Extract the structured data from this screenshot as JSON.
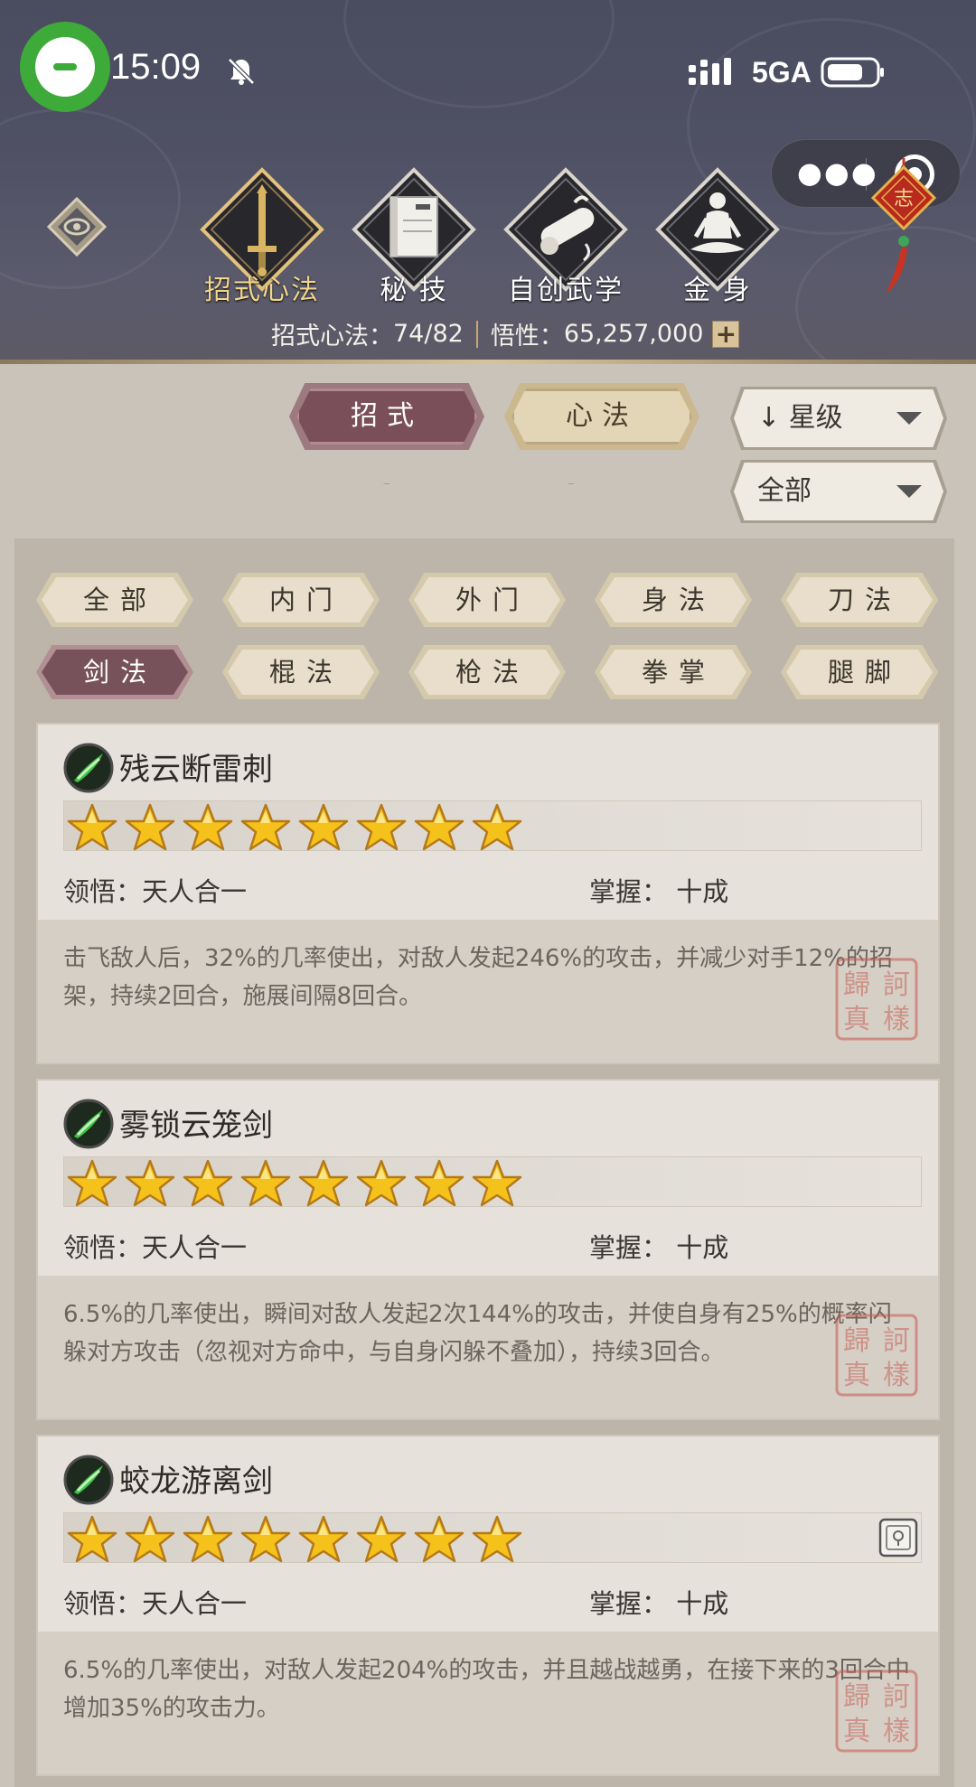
{
  "status_bar": {
    "time": "15:09",
    "network": "5GA"
  },
  "tabs": [
    {
      "label": "招式心法",
      "icon": "sword-icon",
      "active": true
    },
    {
      "label": "秘 技",
      "icon": "book-icon",
      "active": false
    },
    {
      "label": "自创武学",
      "icon": "scroll-icon",
      "active": false
    },
    {
      "label": "金 身",
      "icon": "meditation-icon",
      "active": false
    }
  ],
  "stats": {
    "count_label": "招式心法：",
    "count_value": "74/82",
    "insight_label": "悟性：",
    "insight_value": "65,257,000",
    "plus": "+"
  },
  "toggles": {
    "moves": "招式",
    "methods": "心法"
  },
  "dropdowns": {
    "sort": "星级",
    "sort_arrow": "↓",
    "filter": "全部"
  },
  "filters": [
    "全部",
    "内门",
    "外门",
    "身法",
    "刀法",
    "剑法",
    "棍法",
    "枪法",
    "拳掌",
    "腿脚"
  ],
  "active_filter": "剑法",
  "skills": [
    {
      "name": "残云断雷刺",
      "stars": 8,
      "insight_label": "领悟：",
      "insight_value": "天人合一",
      "mastery_label": "掌握：",
      "mastery_value": "十成",
      "description": "击飞敌人后，32%的几率使出，对敌人发起246%的攻击，并减少对手12%的招架，持续2回合，施展间隔8回合。"
    },
    {
      "name": "雾锁云笼剑",
      "stars": 8,
      "insight_label": "领悟：",
      "insight_value": "天人合一",
      "mastery_label": "掌握：",
      "mastery_value": "十成",
      "description": "6.5%的几率使出，瞬间对敌人发起2次144%的攻击，并使自身有25%的概率闪躲对方攻击（忽视对方命中，与自身闪躲不叠加），持续3回合。"
    },
    {
      "name": "蛟龙游离剑",
      "stars": 8,
      "insight_label": "领悟：",
      "insight_value": "天人合一",
      "mastery_label": "掌握：",
      "mastery_value": "十成",
      "description": "6.5%的几率使出，对敌人发起204%的攻击，并且越战越勇，在接下来的3回合中增加35%的攻击力。"
    }
  ],
  "colors": {
    "header_bg": "#4f5064",
    "active_tab_text": "#f2d68a",
    "active_chip": "#77525b",
    "inactive_chip": "#e8decb",
    "star": "#f5c21b",
    "seal": "#c8574e"
  }
}
